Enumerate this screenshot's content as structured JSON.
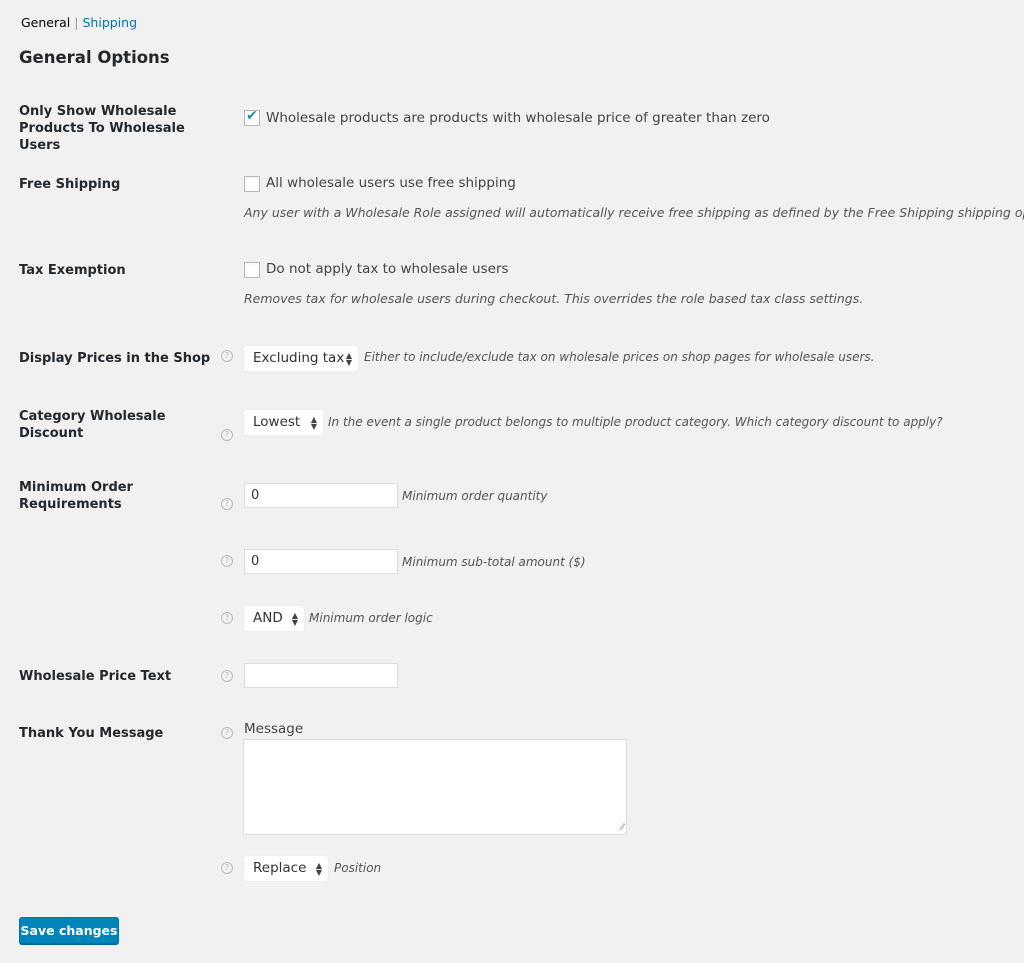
{
  "subnav": {
    "current": "General",
    "separator": "|",
    "link": "Shipping"
  },
  "title": "General Options",
  "fields": {
    "only_show": {
      "label": "Only Show Wholesale Products To Wholesale Users",
      "checkbox_label": "Wholesale products are products with wholesale price of greater than zero",
      "checked": true
    },
    "free_shipping": {
      "label": "Free Shipping",
      "checkbox_label": "All wholesale users use free shipping",
      "checked": false,
      "description": "Any user with a Wholesale Role assigned will automatically receive free shipping as defined by the Free Shipping shipping option."
    },
    "tax_exemption": {
      "label": "Tax Exemption",
      "checkbox_label": "Do not apply tax to wholesale users",
      "checked": false,
      "description": "Removes tax for wholesale users during checkout. This overrides the role based tax class settings."
    },
    "display_prices": {
      "label": "Display Prices in the Shop",
      "value": "Excluding tax",
      "description": "Either to include/exclude tax on wholesale prices on shop pages for wholesale users."
    },
    "category_discount": {
      "label": "Category Wholesale Discount",
      "value": "Lowest",
      "description": "In the event a single product belongs to multiple product category. Which category discount to apply?"
    },
    "min_order": {
      "label": "Minimum Order Requirements",
      "quantity": {
        "value": "0",
        "description": "Minimum order quantity"
      },
      "subtotal": {
        "value": "0",
        "description": "Minimum sub-total amount ($)"
      },
      "logic": {
        "value": "AND",
        "description": "Minimum order logic"
      }
    },
    "price_text": {
      "label": "Wholesale Price Text",
      "value": ""
    },
    "thank_you": {
      "label": "Thank You Message",
      "message_label": "Message",
      "message_value": "",
      "position_value": "Replace",
      "position_description": "Position"
    }
  },
  "icons": {
    "help": "?",
    "check": "✔",
    "arrows": "▲▼",
    "grip": "⁄⁄"
  },
  "save_button": "Save changes",
  "colors": {
    "link": "#0073aa",
    "primary": "#0085ba",
    "background": "#f1f1f1"
  }
}
